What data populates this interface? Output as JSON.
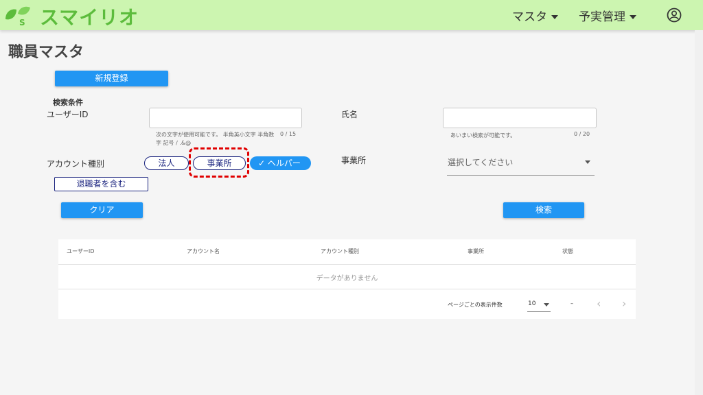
{
  "app": {
    "logo_text": "スマイリオ"
  },
  "nav": {
    "master": "マスタ",
    "plan_actual": "予実管理"
  },
  "page": {
    "title": "職員マスタ"
  },
  "actions": {
    "new_register": "新規登録",
    "clear": "クリア",
    "search": "検索"
  },
  "search": {
    "section_label": "検索条件",
    "user_id_label": "ユーザーID",
    "user_id_value": "",
    "user_id_hint": "次の文字が使用可能です。 半角英小文字 半角数字 記号 / .&@",
    "user_id_counter": "0 / 15",
    "name_label": "氏名",
    "name_value": "",
    "name_hint": "あいまい検索が可能です。",
    "name_counter": "0 / 20",
    "account_type_label": "アカウント種別",
    "chips": {
      "corporate": "法人",
      "office": "事業所",
      "helper": "ヘルパー"
    },
    "include_retired": "退職者を含む",
    "office_label": "事業所",
    "office_placeholder": "選択してください"
  },
  "table": {
    "columns": [
      "ユーザーID",
      "アカウント名",
      "アカウント種別",
      "事業所",
      "状態"
    ],
    "empty_text": "データがありません",
    "per_page_label": "ページごとの表示件数",
    "per_page_value": "10",
    "range_text": "–"
  },
  "colors": {
    "topbar": "#ccf5b0",
    "brand": "#5cbc3c",
    "primary": "#2196f3",
    "chip_border": "#1a237e",
    "highlight": "#e00000"
  }
}
